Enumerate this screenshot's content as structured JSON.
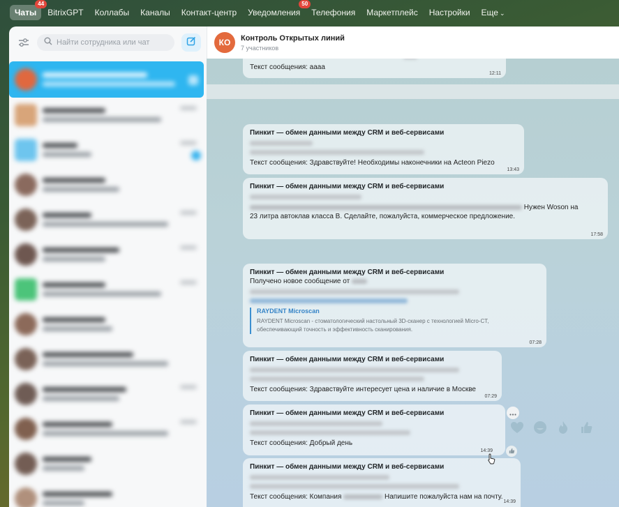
{
  "nav": {
    "items": [
      {
        "label": "Чаты",
        "badge": "44",
        "active": true
      },
      {
        "label": "BitrixGPT"
      },
      {
        "label": "Коллабы"
      },
      {
        "label": "Каналы"
      },
      {
        "label": "Контакт-центр"
      },
      {
        "label": "Уведомления",
        "badge": "50"
      },
      {
        "label": "Телефония"
      },
      {
        "label": "Маркетплейс"
      },
      {
        "label": "Настройки"
      },
      {
        "label": "Еще"
      }
    ]
  },
  "sidebar": {
    "search_placeholder": "Найти сотрудника или чат"
  },
  "chat": {
    "avatar_initials": "КО",
    "avatar_color": "#e36a3d",
    "title": "Контроль Открытых линий",
    "subtitle": "7 участников"
  },
  "messages": [
    {
      "text": "Текст сообщения: аааа",
      "time": "12:11"
    },
    {
      "sender": "Пинкит — обмен данными между CRM и веб-сервисами",
      "text": "Текст сообщения: Здравствуйте! Необходимы наконечники на Acteon Piezo",
      "time": "13:43"
    },
    {
      "sender": "Пинкит — обмен данными между CRM и веб-сервисами",
      "text_tail": "Нужен Woson на",
      "text": "23 литра автоклав класса B. Сделайте, пожалуйста, коммерческое предложение.",
      "time": "17:58"
    },
    {
      "sender": "Пинкит — обмен данными между CRM и веб-сервисами",
      "text": "Получено новое сообщение от",
      "preview_title": "RAYDENT Microscan",
      "preview_desc_1": "RAYDENT Microscan - стоматологический настольный 3D-сканер с технологией Micro-CT,",
      "preview_desc_2": "обеспечивающий точность и эффективность сканирования.",
      "time": "07:28"
    },
    {
      "sender": "Пинкит — обмен данными между CRM и веб-сервисами",
      "text": "Текст сообщения: Здравствуйте интересует цена и наличие в Москве",
      "time": "07:29"
    },
    {
      "sender": "Пинкит — обмен данными между CRM и веб-сервисами",
      "text": "Текст сообщения: Добрый день",
      "time": "14:39"
    },
    {
      "sender": "Пинкит — обмен данными между CRM и веб-сервисами",
      "text_prefix": "Текст сообщения: Компания",
      "text_suffix": "Напишите пожалуйста нам на почту.",
      "time": "14:39"
    }
  ],
  "colors": {
    "accent": "#2fb6f0",
    "badge": "#e2463b",
    "link": "#3584c7"
  }
}
